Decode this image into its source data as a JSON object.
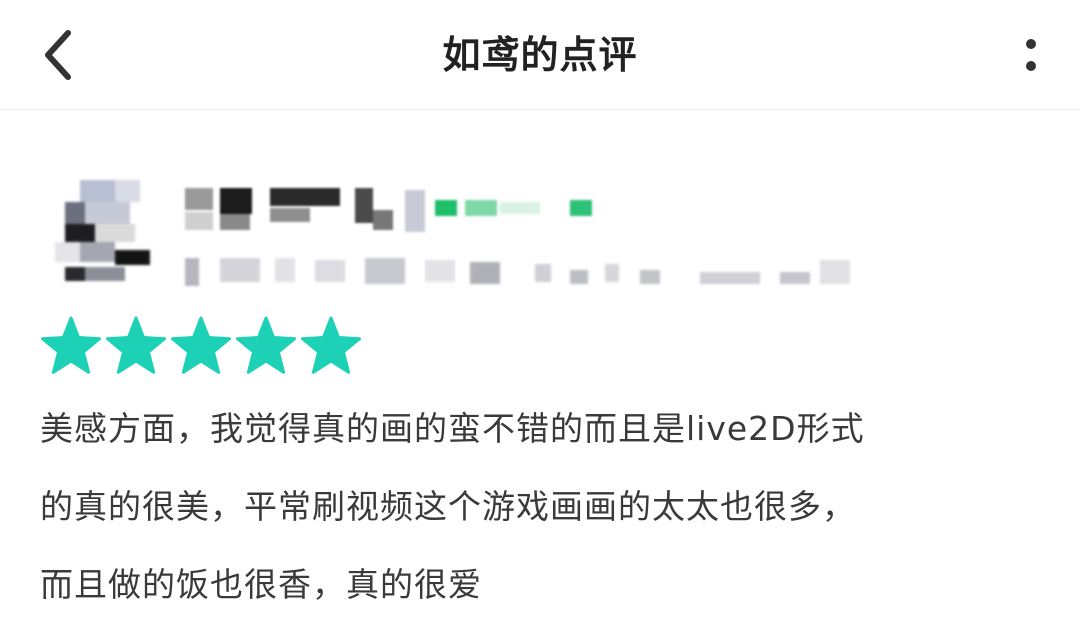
{
  "header": {
    "title": "如鸢的点评",
    "back_icon": "chevron-left-icon",
    "more_icon": "more-vertical-icon"
  },
  "review": {
    "rating": 5,
    "rating_max": 5,
    "star_color": "#1dd1b7",
    "lines": [
      "美感方面，我觉得真的画的蛮不错的而且是live2D形式",
      "的真的很美，平常刷视频这个游戏画画的太太也很多，",
      "而且做的饭也很香，真的很爱"
    ]
  },
  "colors": {
    "text": "#3a3a3a",
    "title": "#222222",
    "accent": "#1dd1b7",
    "divider": "#eeeeee"
  }
}
